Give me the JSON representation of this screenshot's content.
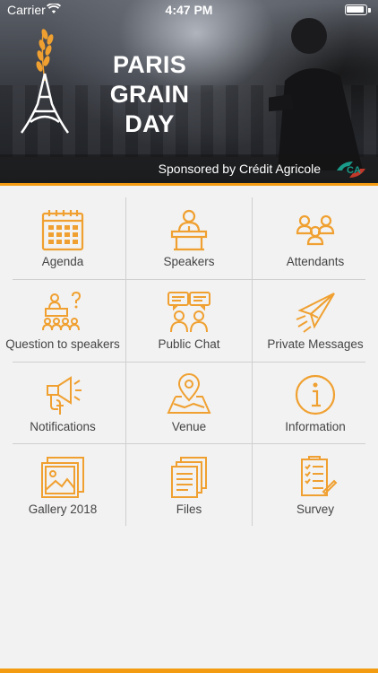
{
  "status_bar": {
    "carrier": "Carrier",
    "time": "4:47 PM"
  },
  "header": {
    "title_line1": "PARIS GRAIN",
    "title_line2": "DAY",
    "sponsor": "Sponsored by Crédit Agricole"
  },
  "colors": {
    "accent": "#f39c12",
    "icon": "#f0a030",
    "divider": "#cfcfcf",
    "background": "#f2f2f2"
  },
  "menu": [
    {
      "label": "Agenda",
      "icon": "calendar-icon"
    },
    {
      "label": "Speakers",
      "icon": "speaker-podium-icon"
    },
    {
      "label": "Attendants",
      "icon": "attendants-icon"
    },
    {
      "label": "Question to speakers",
      "icon": "question-audience-icon"
    },
    {
      "label": "Public Chat",
      "icon": "public-chat-icon"
    },
    {
      "label": "Private Messages",
      "icon": "paper-plane-icon"
    },
    {
      "label": "Notifications",
      "icon": "megaphone-icon"
    },
    {
      "label": "Venue",
      "icon": "map-pin-icon"
    },
    {
      "label": "Information",
      "icon": "info-icon"
    },
    {
      "label": "Gallery 2018",
      "icon": "gallery-icon"
    },
    {
      "label": "Files",
      "icon": "files-icon"
    },
    {
      "label": "Survey",
      "icon": "survey-icon"
    }
  ]
}
